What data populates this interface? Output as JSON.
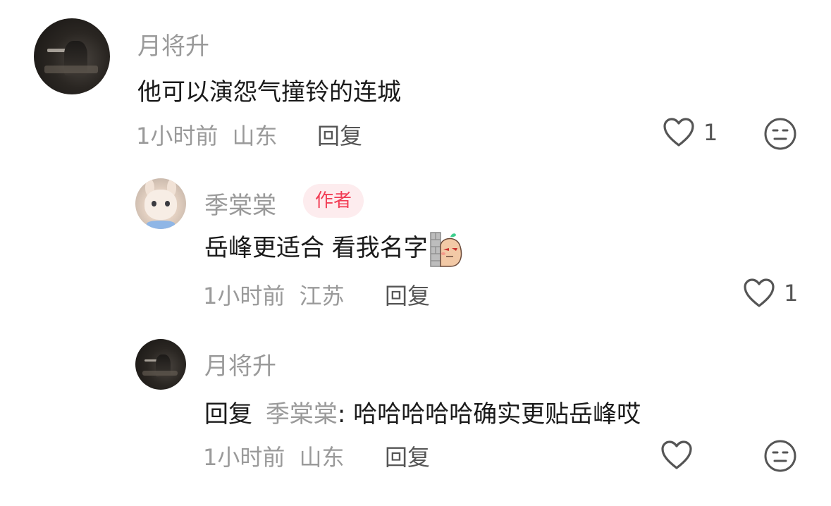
{
  "comments": [
    {
      "author": "月将升",
      "text": "他可以演怨气撞铃的连城",
      "time": "1小时前",
      "location": "山东",
      "reply_label": "回复",
      "likes": "1",
      "avatar_icon": "dark-portrait-avatar",
      "dislike_icon": "meh-face-icon"
    },
    {
      "author": "季棠棠",
      "badge": "作者",
      "text": "岳峰更适合 看我名字",
      "sticker_icon": "peeking-peanut-sticker",
      "time": "1小时前",
      "location": "江苏",
      "reply_label": "回复",
      "likes": "1",
      "avatar_icon": "bunny-avatar"
    },
    {
      "author": "月将升",
      "reply_prefix": "回复",
      "reply_to": "季棠棠",
      "text": ": 哈哈哈哈哈确实更贴岳峰哎",
      "time": "1小时前",
      "location": "山东",
      "reply_label": "回复",
      "likes": "",
      "avatar_icon": "dark-portrait-avatar",
      "dislike_icon": "meh-face-icon"
    }
  ],
  "colors": {
    "badge_bg": "#fdecee",
    "badge_text": "#f23e56",
    "secondary_text": "#9a9a9a",
    "primary_text": "#1a1a1a"
  }
}
